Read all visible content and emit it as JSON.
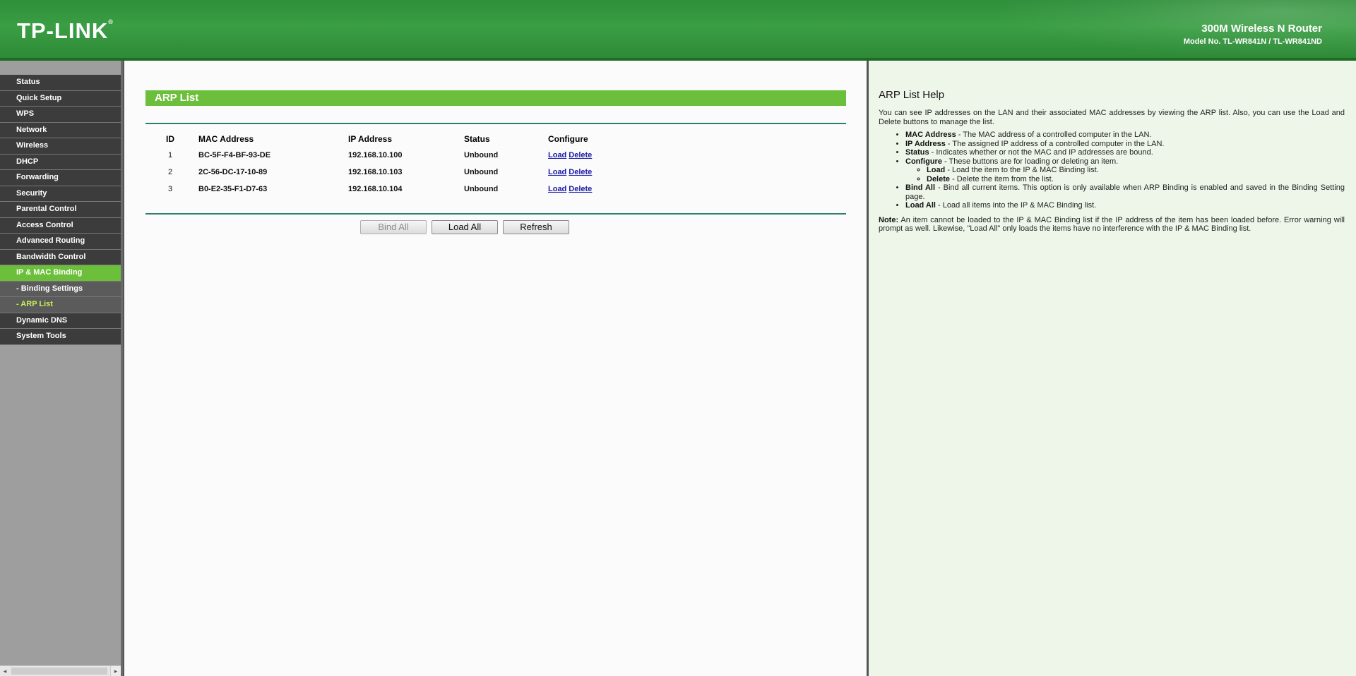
{
  "header": {
    "logo": "TP-LINK",
    "logo_mark": "®",
    "product_title": "300M Wireless N Router",
    "model": "Model No. TL-WR841N / TL-WR841ND"
  },
  "sidebar": {
    "items": [
      {
        "label": "Status"
      },
      {
        "label": "Quick Setup"
      },
      {
        "label": "WPS"
      },
      {
        "label": "Network"
      },
      {
        "label": "Wireless"
      },
      {
        "label": "DHCP"
      },
      {
        "label": "Forwarding"
      },
      {
        "label": "Security"
      },
      {
        "label": "Parental Control"
      },
      {
        "label": "Access Control"
      },
      {
        "label": "Advanced Routing"
      },
      {
        "label": "Bandwidth Control"
      },
      {
        "label": "IP & MAC Binding"
      },
      {
        "label": "- Binding Settings"
      },
      {
        "label": "- ARP List"
      },
      {
        "label": "Dynamic DNS"
      },
      {
        "label": "System Tools"
      }
    ]
  },
  "main": {
    "title": "ARP List",
    "columns": [
      "ID",
      "MAC Address",
      "IP Address",
      "Status",
      "Configure"
    ],
    "rows": [
      {
        "id": "1",
        "mac": "BC-5F-F4-BF-93-DE",
        "ip": "192.168.10.100",
        "status": "Unbound",
        "load": "Load",
        "delete": "Delete"
      },
      {
        "id": "2",
        "mac": "2C-56-DC-17-10-89",
        "ip": "192.168.10.103",
        "status": "Unbound",
        "load": "Load",
        "delete": "Delete"
      },
      {
        "id": "3",
        "mac": "B0-E2-35-F1-D7-63",
        "ip": "192.168.10.104",
        "status": "Unbound",
        "load": "Load",
        "delete": "Delete"
      }
    ],
    "buttons": {
      "bind_all": "Bind All",
      "load_all": "Load All",
      "refresh": "Refresh"
    }
  },
  "help": {
    "title": "ARP List Help",
    "intro": "You can see IP addresses on the LAN and their associated MAC addresses by viewing the ARP list. Also, you can use the Load and Delete buttons to manage the list.",
    "items": [
      {
        "term": "MAC Address",
        "desc": " - The MAC address of a controlled computer in the LAN."
      },
      {
        "term": "IP Address",
        "desc": " - The assigned IP address of a controlled computer in the LAN."
      },
      {
        "term": "Status",
        "desc": " - Indicates whether or not the MAC and IP addresses are bound."
      },
      {
        "term": "Configure",
        "desc": " - These buttons are for loading or deleting an item."
      },
      {
        "term": "Bind All",
        "desc": " - Bind all current items. This option is only available when ARP Binding is enabled and saved in the Binding Setting page."
      },
      {
        "term": "Load All",
        "desc": " - Load all items into the IP & MAC Binding list."
      }
    ],
    "sub_items": [
      {
        "term": "Load",
        "desc": " - Load the item to the IP & MAC Binding list."
      },
      {
        "term": "Delete",
        "desc": " - Delete the item from the list."
      }
    ],
    "note_label": "Note:",
    "note": " An item cannot be loaded to the IP & MAC Binding list if the IP address of the item has been loaded before. Error warning will prompt as well. Likewise, \"Load All\" only loads the items have no interference with the IP & MAC Binding list."
  },
  "colors": {
    "header_green": "#3a9e44",
    "accent_green": "#6cbf3a",
    "menu_dark": "#3c3c3c",
    "help_bg": "#eef6ea",
    "link": "#1a1aa6"
  }
}
